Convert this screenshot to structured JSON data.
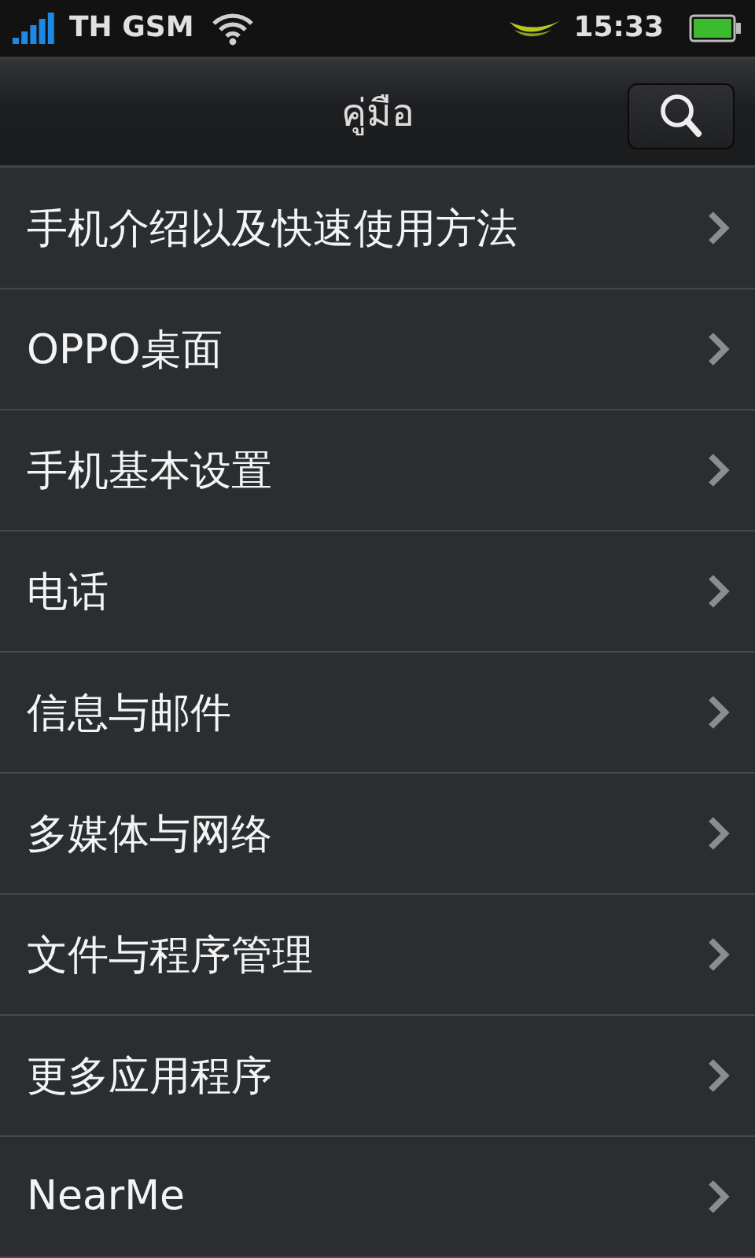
{
  "status_bar": {
    "carrier": "TH GSM",
    "time": "15:33"
  },
  "header": {
    "title": "คู่มือ"
  },
  "menu": [
    {
      "label": "手机介绍以及快速使用方法"
    },
    {
      "label": "OPPO桌面"
    },
    {
      "label": "手机基本设置"
    },
    {
      "label": "电话"
    },
    {
      "label": "信息与邮件"
    },
    {
      "label": "多媒体与网络"
    },
    {
      "label": "文件与程序管理"
    },
    {
      "label": "更多应用程序"
    },
    {
      "label": "NearMe"
    }
  ]
}
